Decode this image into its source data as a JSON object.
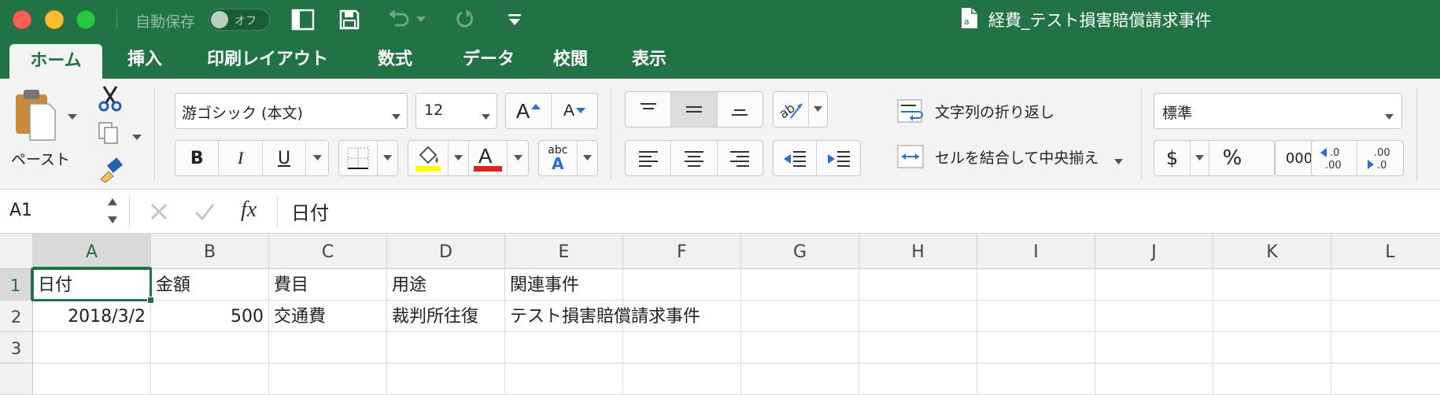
{
  "titlebar": {
    "autosave_label": "自動保存",
    "autosave_state": "オフ",
    "document_title": "経費_テスト損害賠償請求事件"
  },
  "tabs": [
    "ホーム",
    "挿入",
    "印刷レイアウト",
    "数式",
    "データ",
    "校閲",
    "表示"
  ],
  "active_tab": "ホーム",
  "ribbon": {
    "paste_label": "ペースト",
    "font_name": "游ゴシック (本文)",
    "font_size": "12",
    "bold": "B",
    "italic": "I",
    "underline": "U",
    "grow_font": "A",
    "shrink_font": "A",
    "font_color_glyph": "A",
    "phonetic_top": "abc",
    "phonetic_bottom": "A",
    "wrap_text": "文字列の折り返し",
    "merge_center": "セルを結合して中央揃え",
    "number_format": "標準",
    "currency": "$",
    "percent": "%",
    "comma": "000",
    "inc_decimal": ".0 .00",
    "dec_decimal": ".00 .0",
    "accent_fill": "#ffff00",
    "accent_font": "#e0201b"
  },
  "formula_bar": {
    "name_box": "A1",
    "fx": "fx",
    "value": "日付"
  },
  "grid": {
    "columns": [
      "A",
      "B",
      "C",
      "D",
      "E",
      "F",
      "G",
      "H",
      "I",
      "J",
      "K",
      "L"
    ],
    "rows": [
      "1",
      "2",
      "3"
    ],
    "selected_cell": "A1",
    "cells": {
      "A1": "日付",
      "B1": "金額",
      "C1": "費目",
      "D1": "用途",
      "E1": "関連事件",
      "A2": "2018/3/2",
      "B2": "500",
      "C2": "交通費",
      "D2": "裁判所往復",
      "E2": "テスト損害賠償請求事件"
    }
  },
  "colors": {
    "brand": "#217346",
    "ribbon_bg": "#f3f3f3"
  }
}
